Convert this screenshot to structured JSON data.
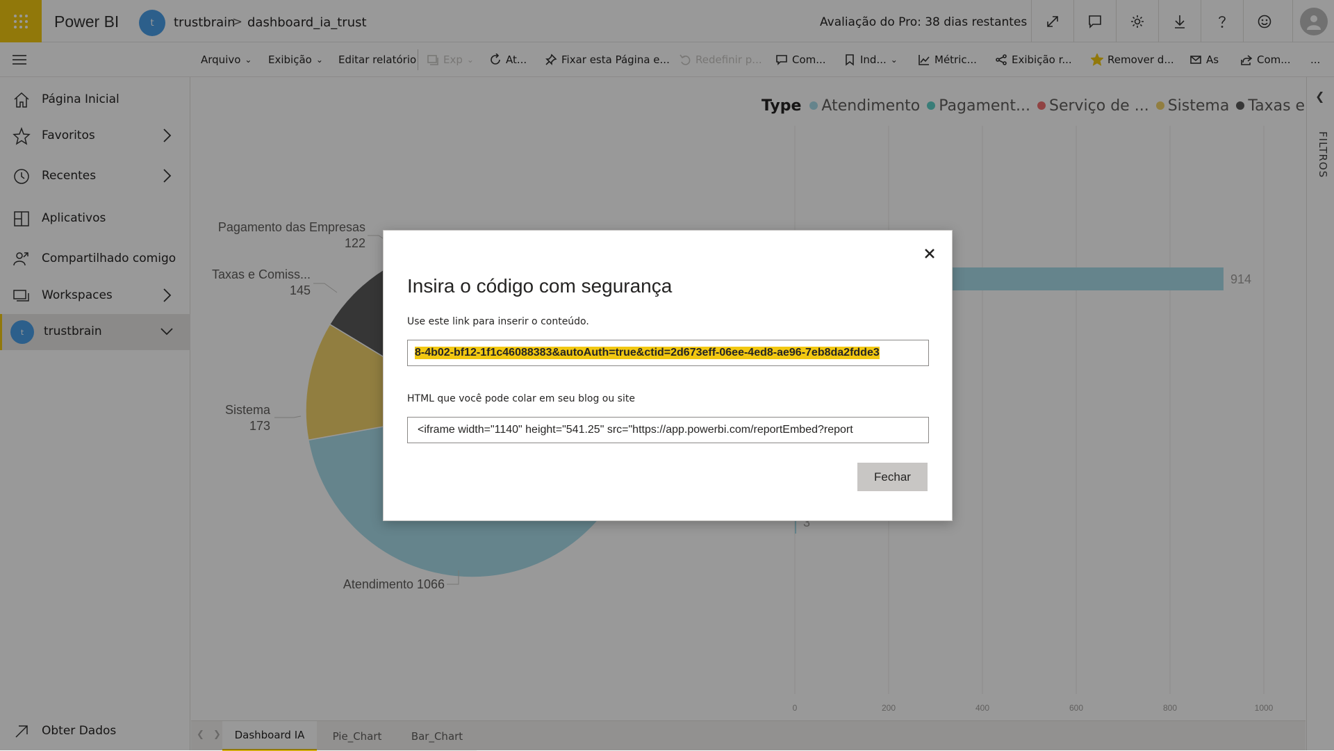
{
  "topbar": {
    "brand": "Power BI",
    "workspace_initial": "t",
    "workspace": "trustbrain",
    "separator": ">",
    "report": "dashboard_ia_trust",
    "trial": "Avaliação do Pro: 38 dias restantes",
    "icons": [
      "expand-icon",
      "comment-icon",
      "settings-icon",
      "download-icon",
      "help-icon",
      "feedback-icon",
      "profile-icon"
    ]
  },
  "toolbar": {
    "items": [
      {
        "label": "Arquivo",
        "dropdown": true
      },
      {
        "label": "Exibição",
        "dropdown": true
      },
      {
        "label": "Editar relatório"
      },
      {
        "label": "Exp",
        "disabled": true
      },
      {
        "label": "At..."
      },
      {
        "label": "Fixar esta Página e..."
      },
      {
        "label": "Redefinir p...",
        "disabled": true
      },
      {
        "label": "Com..."
      },
      {
        "label": "Ind...",
        "dropdown": true
      },
      {
        "label": "Métric..."
      },
      {
        "label": "Exibição r..."
      },
      {
        "label": "Remover d..."
      },
      {
        "label": "As"
      },
      {
        "label": "Com..."
      },
      {
        "label": "..."
      }
    ]
  },
  "sidebar": {
    "items": [
      {
        "label": "Página Inicial"
      },
      {
        "label": "Favoritos"
      },
      {
        "label": "Recentes"
      },
      {
        "label": "Aplicativos"
      },
      {
        "label": "Compartilhado comigo"
      },
      {
        "label": "Workspaces"
      },
      {
        "label": "trustbrain",
        "initial": "t"
      }
    ],
    "footer": "Obter Dados"
  },
  "filters": {
    "label": "FILTROS"
  },
  "page_tabs": [
    "Dashboard IA",
    "Pie_Chart",
    "Bar_Chart"
  ],
  "colors": {
    "accent": "#f2c811",
    "workspace_avatar": "#4a9fe8",
    "atendimento": "#a8dcea",
    "pagamento": "#5fd0c8",
    "servico": "#f07070",
    "sistema": "#f2d36b",
    "taxas": "#5a5a5a"
  },
  "chart_data": [
    {
      "type": "pie",
      "categories": [
        "Atendimento",
        "Sistema",
        "Taxas e Comiss...",
        "Pagamento das Empresas"
      ],
      "values": [
        1066,
        173,
        145,
        122
      ],
      "labels": [
        "Atendimento 1066",
        "Sistema",
        "173",
        "Taxas e Comiss...",
        "145",
        "Pagamento das Empresas",
        "122"
      ]
    },
    {
      "type": "bar",
      "legend_title": "Type",
      "legend": [
        "Atendimento",
        "Pagament...",
        "Serviço de ...",
        "Sistema",
        "Taxas e ..."
      ],
      "series": [
        {
          "values": [
            914,
            3
          ]
        }
      ],
      "data_labels": [
        "914",
        "3"
      ],
      "x_ticks": [
        "0",
        "200",
        "400",
        "600",
        "800",
        "1000"
      ],
      "xlim": [
        0,
        1000
      ]
    }
  ],
  "modal": {
    "title": "Insira o código com segurança",
    "link_label": "Use este link para inserir o conteúdo.",
    "link_value": "8-4b02-bf12-1f1c46088383&autoAuth=true&ctid=2d673eff-06ee-4ed8-ae96-7eb8da2fdde3",
    "html_label": "HTML que você pode colar em seu blog ou site",
    "html_value": "<iframe width=\"1140\" height=\"541.25\" src=\"https://app.powerbi.com/reportEmbed?report",
    "close_label": "Fechar"
  }
}
